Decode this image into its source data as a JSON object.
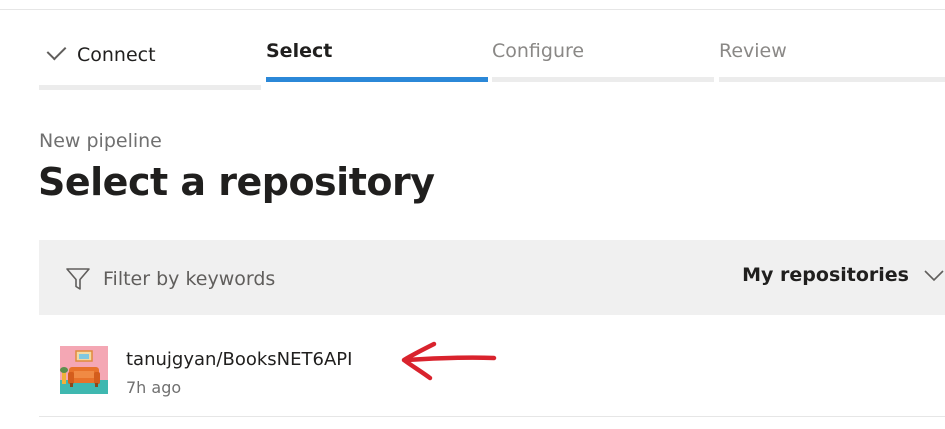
{
  "wizard": {
    "steps": [
      {
        "label": "Connect",
        "state": "completed"
      },
      {
        "label": "Select",
        "state": "active"
      },
      {
        "label": "Configure",
        "state": "pending"
      },
      {
        "label": "Review",
        "state": "pending"
      }
    ]
  },
  "header": {
    "subtitle": "New pipeline",
    "title": "Select a repository"
  },
  "filter": {
    "placeholder": "Filter by keywords",
    "scope_label": "My repositories"
  },
  "repositories": [
    {
      "name": "tanujgyan/BooksNET6API",
      "updated": "7h ago",
      "icon": "repo-avatar-icon"
    }
  ],
  "colors": {
    "accent": "#2b88d8",
    "annotation_arrow": "#d9232d",
    "filter_bg": "#f0f0f0"
  }
}
